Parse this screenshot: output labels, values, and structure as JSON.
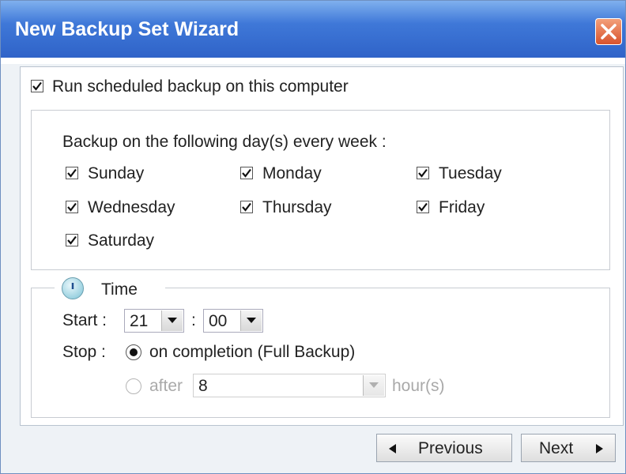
{
  "window": {
    "title": "New Backup Set Wizard"
  },
  "schedule": {
    "run_label": "Run scheduled backup on this computer",
    "days_heading": "Backup on the following day(s) every week :",
    "days": [
      {
        "label": "Sunday",
        "checked": true
      },
      {
        "label": "Monday",
        "checked": true
      },
      {
        "label": "Tuesday",
        "checked": true
      },
      {
        "label": "Wednesday",
        "checked": true
      },
      {
        "label": "Thursday",
        "checked": true
      },
      {
        "label": "Friday",
        "checked": true
      },
      {
        "label": "Saturday",
        "checked": true
      }
    ]
  },
  "time": {
    "legend": "Time",
    "start_label": "Start :",
    "start_hour": "21",
    "separator": ":",
    "start_minute": "00",
    "stop_label": "Stop :",
    "stop_option1": "on completion (Full Backup)",
    "stop_option2": "after",
    "after_value": "8",
    "hours_unit": "hour(s)"
  },
  "buttons": {
    "previous": "Previous",
    "next": "Next"
  }
}
